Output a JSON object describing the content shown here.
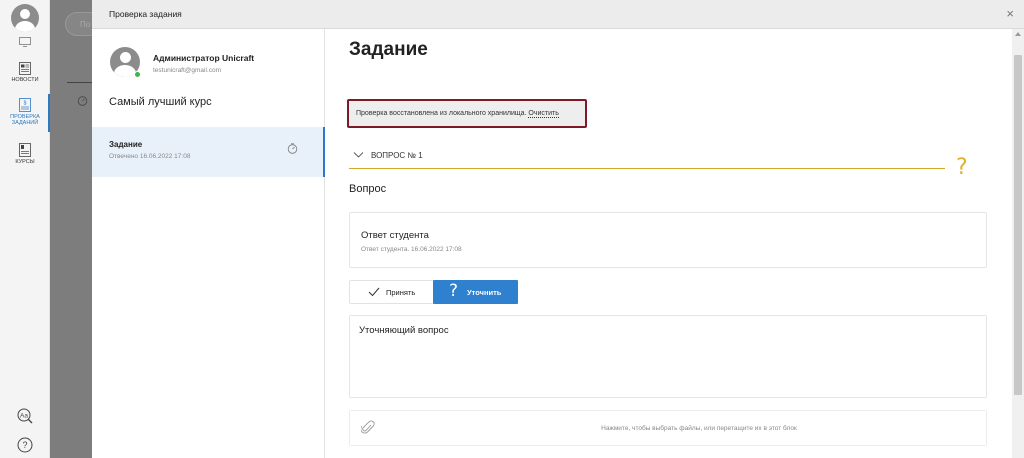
{
  "rail": {
    "news_label": "НОВОСТИ",
    "review_label_1": "ПРОВЕРКА",
    "review_label_2": "ЗАДАНИЙ",
    "courses_label": "КУРСЫ",
    "accent": "#2b78c5"
  },
  "background": {
    "search_placeholder": "По"
  },
  "modal": {
    "title": "Проверка задания",
    "close_icon": "×"
  },
  "sidebar": {
    "user_name": "Администратор Unicraft",
    "user_email": "testunicraft@gmail.com",
    "course_title": "Самый лучший курс",
    "task": {
      "name": "Задание",
      "status": "Отвечено 16.06.2022 17:08"
    }
  },
  "main": {
    "title": "Задание",
    "restore_message": "Проверка восстановлена из локального хранилища.",
    "clear_link": "Очистить",
    "question_label": "ВОПРОС № 1",
    "question_mark": "?",
    "question_heading": "Вопрос",
    "answer": {
      "title": "Ответ студента",
      "meta": "Ответ студента. 16.06.2022 17:08"
    },
    "accept_label": "Принять",
    "clarify_label": "Уточнить",
    "clarify_text": "Уточняющий вопрос",
    "dropzone_text": "Нажмите, чтобы выбрать файлы, или перетащите их в этот блок",
    "highlight_color": "#7d1a2a",
    "question_color": "#e0b12c"
  }
}
